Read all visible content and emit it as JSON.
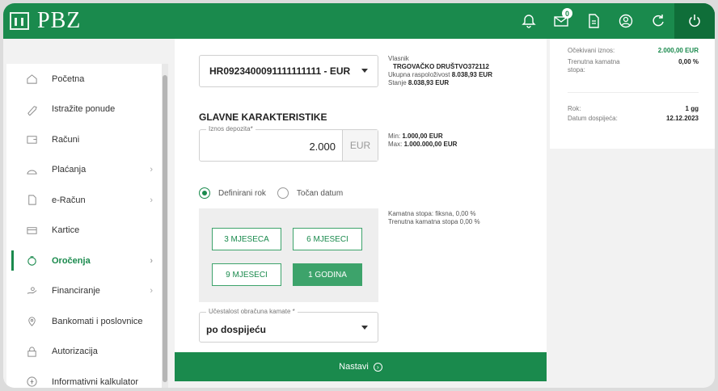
{
  "header": {
    "logo_text": "PBZ",
    "message_badge": "0",
    "icons": [
      "bell-icon",
      "mail-icon",
      "document-icon",
      "user-icon",
      "refresh-icon",
      "power-icon"
    ]
  },
  "sidebar": {
    "items": [
      {
        "label": "Početna",
        "icon": "home-icon"
      },
      {
        "label": "Istražite ponude",
        "icon": "tag-icon"
      },
      {
        "label": "Računi",
        "icon": "wallet-icon"
      },
      {
        "label": "Plaćanja",
        "icon": "payment-icon"
      },
      {
        "label": "e-Račun",
        "icon": "e-invoice-icon"
      },
      {
        "label": "Kartice",
        "icon": "card-icon"
      },
      {
        "label": "Oročenja",
        "icon": "piggy-bank-icon"
      },
      {
        "label": "Financiranje",
        "icon": "financing-icon"
      },
      {
        "label": "Bankomati i poslovnice",
        "icon": "location-icon"
      },
      {
        "label": "Autorizacija",
        "icon": "lock-icon"
      },
      {
        "label": "Informativni kalkulator",
        "icon": "calculator-icon"
      }
    ]
  },
  "account": {
    "selected": "HR0923400091111111111 - EUR",
    "owner_label": "Vlasnik",
    "owner_name": "TRGOVAČKO DRUŠTVO372112",
    "available_label": "Ukupna raspoloživost",
    "available_value": "8.038,93 EUR",
    "balance_label": "Stanje",
    "balance_value": "8.038,93 EUR"
  },
  "main": {
    "section_title": "GLAVNE KARAKTERISTIKE",
    "deposit_label": "Iznos depozita*",
    "deposit_value": "2.000",
    "deposit_currency": "EUR",
    "min_label": "Min:",
    "min_value": "1.000,00 EUR",
    "max_label": "Max:",
    "max_value": "1.000.000,00 EUR",
    "radio_defined": "Definirani rok",
    "radio_date": "Točan datum",
    "rate_label": "Kamatna stopa:",
    "rate_value": "fiksna, 0,00 %",
    "current_rate_label": "Trenutna kamatna stopa",
    "current_rate_value": "0,00 %",
    "terms": [
      "3 MJESECA",
      "6 MJESECI",
      "9 MJESECI",
      "1 GODINA"
    ],
    "selected_term": "1 GODINA",
    "frequency_label": "Učestalost obračuna kamate *",
    "frequency_value": "po dospijeću",
    "next_button": "Nastavi"
  },
  "summary": {
    "expected_label": "Očekivani iznos:",
    "expected_value": "2.000,00 EUR",
    "current_rate_label": "Trenutna kamatna stopa:",
    "current_rate_value": "0,00 %",
    "term_label": "Rok:",
    "term_value": "1 gg",
    "due_label": "Datum dospijeća:",
    "due_value": "12.12.2023"
  },
  "colors": {
    "brand_green": "#1a8a4d",
    "term_green": "#3da36b"
  }
}
